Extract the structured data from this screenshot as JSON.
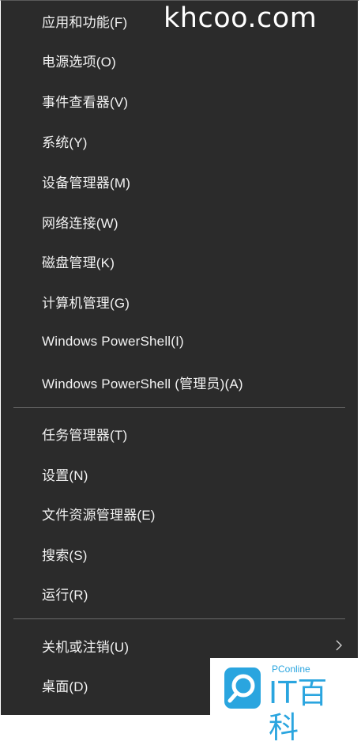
{
  "watermark": "khcoo.com",
  "menu": {
    "group1": [
      {
        "label": "应用和功能(F)"
      },
      {
        "label": "电源选项(O)"
      },
      {
        "label": "事件查看器(V)"
      },
      {
        "label": "系统(Y)"
      },
      {
        "label": "设备管理器(M)"
      },
      {
        "label": "网络连接(W)"
      },
      {
        "label": "磁盘管理(K)"
      },
      {
        "label": "计算机管理(G)"
      },
      {
        "label": "Windows PowerShell(I)"
      },
      {
        "label": "Windows PowerShell (管理员)(A)"
      }
    ],
    "group2": [
      {
        "label": "任务管理器(T)"
      },
      {
        "label": "设置(N)"
      },
      {
        "label": "文件资源管理器(E)"
      },
      {
        "label": "搜索(S)"
      },
      {
        "label": "运行(R)"
      }
    ],
    "group3": [
      {
        "label": "关机或注销(U)",
        "submenu_icon": "chevron-right-icon"
      },
      {
        "label": "桌面(D)"
      }
    ]
  },
  "logo": {
    "small": "PConline",
    "big": "IT百科",
    "icon": "magnifier-icon"
  },
  "colors": {
    "menu_bg": "#2b2b2b",
    "text": "#f2f2f2",
    "separator": "#6b6b6b",
    "logo_blue": "#2aa5df"
  }
}
